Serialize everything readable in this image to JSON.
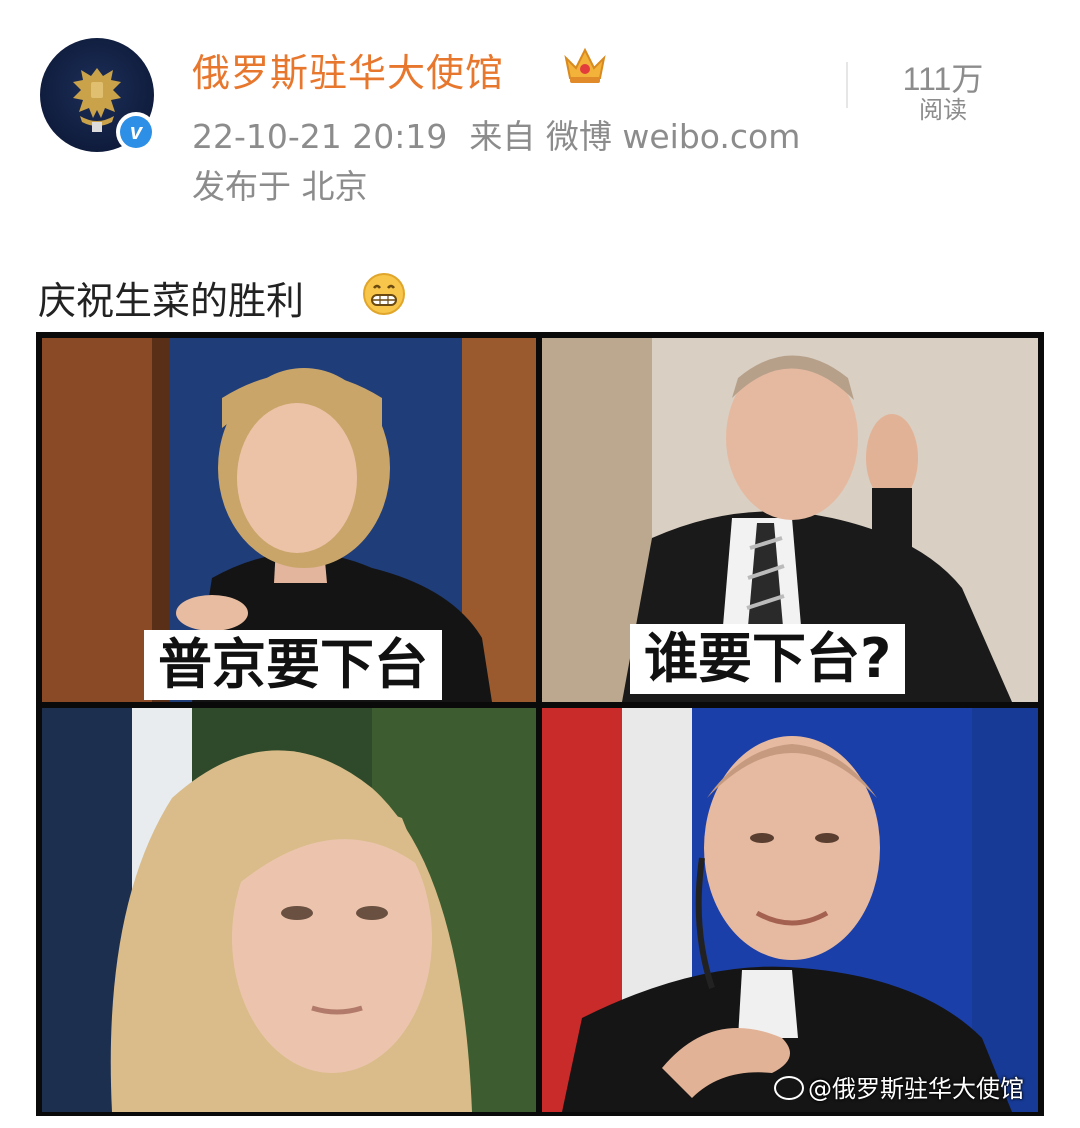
{
  "post": {
    "username": "俄罗斯驻华大使馆",
    "date": "22-10-21 20:19",
    "source": "来自 微博 weibo.com",
    "location": "发布于 北京",
    "reads_count": "111万",
    "reads_label": "阅读",
    "text": "庆祝生菜的胜利"
  },
  "meme": {
    "caption_top_left": "普京要下台",
    "caption_top_right": "谁要下台?",
    "watermark": "@俄罗斯驻华大使馆"
  },
  "icons": {
    "avatar": "double-headed-eagle-emblem",
    "verified": "verified-badge-icon",
    "crown": "crown-icon",
    "emoji": "grin-emoji-icon"
  },
  "colors": {
    "username": "#e8772e",
    "meta": "#8c8c8c",
    "verified": "#2d8fe6",
    "text": "#222222"
  }
}
